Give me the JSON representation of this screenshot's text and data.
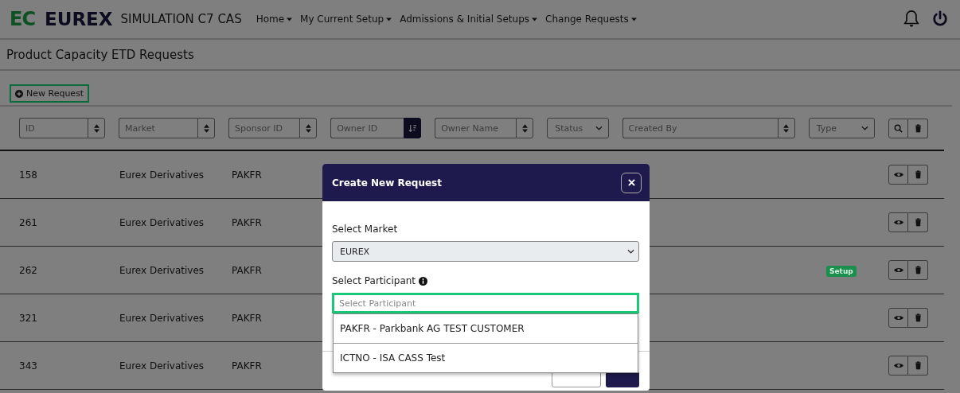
{
  "header": {
    "logo_mark": "EC",
    "logo_text": "EUREX",
    "app_title": "SIMULATION C7 CAS",
    "menu": [
      {
        "label": "Home"
      },
      {
        "label": "My Current Setup"
      },
      {
        "label": "Admissions & Initial Setups"
      },
      {
        "label": "Change Requests"
      }
    ]
  },
  "page_title": "Product Capacity ETD Requests",
  "new_request_button": {
    "label": "New Request",
    "focused": true
  },
  "filters": [
    {
      "kind": "sort",
      "placeholder": "ID",
      "active": false
    },
    {
      "kind": "sort",
      "placeholder": "Market",
      "active": false
    },
    {
      "kind": "sort",
      "placeholder": "Sponsor ID",
      "active": false
    },
    {
      "kind": "sort",
      "placeholder": "Owner ID",
      "active": true
    },
    {
      "kind": "sort",
      "placeholder": "Owner Name",
      "active": false
    },
    {
      "kind": "select",
      "placeholder": "Status"
    },
    {
      "kind": "sort",
      "placeholder": "Created By",
      "active": false
    },
    {
      "kind": "select",
      "placeholder": "Type"
    }
  ],
  "rows": [
    {
      "id": "158",
      "market": "Eurex Derivatives",
      "sponsor_id": "PAKFR"
    },
    {
      "id": "261",
      "market": "Eurex Derivatives",
      "sponsor_id": "PAKFR"
    },
    {
      "id": "262",
      "market": "Eurex Derivatives",
      "sponsor_id": "PAKFR",
      "type": {
        "label": "Setup",
        "color": "#1a8f4e"
      }
    },
    {
      "id": "321",
      "market": "Eurex Derivatives",
      "sponsor_id": "PAKFR"
    },
    {
      "id": "343",
      "market": "Eurex Derivatives",
      "sponsor_id": "PAKFR"
    }
  ],
  "modal": {
    "title": "Create New Request",
    "market_label": "Select Market",
    "market_value": "EUREX",
    "participant_label": "Select Participant",
    "participant_placeholder": "Select Participant",
    "participant_focused": true,
    "options": [
      "PAKFR - Parkbank AG TEST CUSTOMER",
      "ICTNO - ISA CASS Test"
    ]
  }
}
